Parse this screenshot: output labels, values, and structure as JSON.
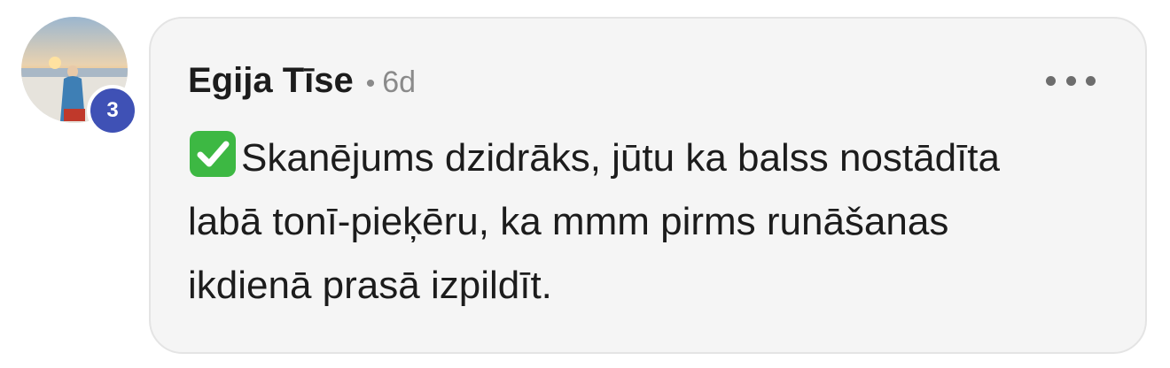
{
  "comment": {
    "avatar_icon": "user-photo-beach",
    "badge_count": "3",
    "author": "Egija Tīse",
    "separator": "•",
    "time": "6d",
    "more_icon": "more-horizontal-icon",
    "status_icon": "check-mark-button-emoji",
    "text_line1": "Skanējums dzidrāks, jūtu ka balss nostādīta",
    "text_line2": "labā tonī-pieķēru, ka mmm pirms runāšanas",
    "text_line3": "ikdienā prasā izpildīt."
  },
  "colors": {
    "bubble_bg": "#f5f5f5",
    "badge_bg": "#3f51b5",
    "check_green": "#3db843"
  }
}
